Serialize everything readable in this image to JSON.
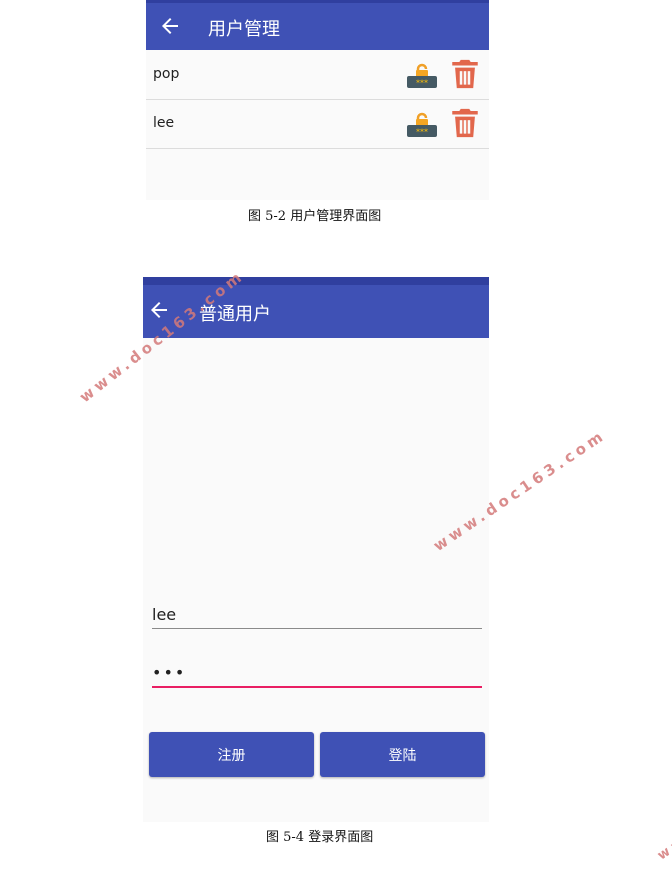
{
  "screen1": {
    "title": "用户管理",
    "users": [
      {
        "name": "pop"
      },
      {
        "name": "lee"
      }
    ]
  },
  "caption1": "图 5-2  用户管理界面图",
  "screen2": {
    "title": "普通用户",
    "username_value": "lee",
    "password_value": "•••",
    "register_label": "注册",
    "login_label": "登陆"
  },
  "caption2": "图 5-4 登录界面图",
  "watermark": "www.doc163.com",
  "colors": {
    "primary": "#3f51b5",
    "primary_dark": "#303f9f",
    "delete": "#e2674c",
    "accent_underline": "#e91e63"
  }
}
